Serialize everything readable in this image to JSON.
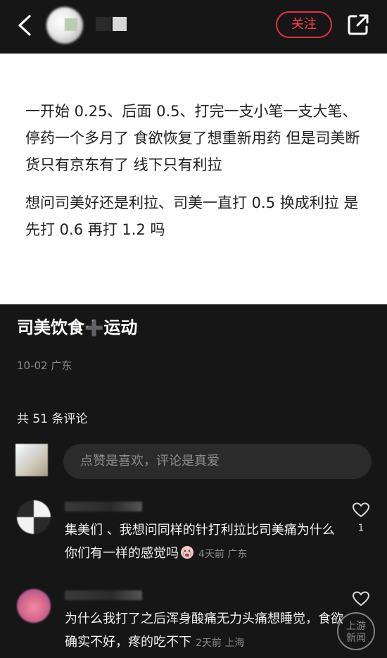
{
  "header": {
    "follow_label": "关注"
  },
  "post": {
    "paragraphs": [
      "一开始 0.25、后面 0.5、打完一支小笔一支大笔、停药一个多月了 食欲恢复了想重新用药 但是司美断货只有京东有了 线下只有利拉",
      "想问司美好还是利拉、司美一直打 0.5 换成利拉 是先打 0.6 再打 1.2 吗"
    ],
    "title_part1": "司美饮食",
    "title_plus": "➕",
    "title_part2": "运动",
    "meta": "10-02 广东"
  },
  "comments_section": {
    "count_label": "共 51 条评论",
    "input_placeholder": "点赞是喜欢，评论是真爱"
  },
  "comments": [
    {
      "text": "集美们 、我想问同样的针打利拉比司美痛为什么 你们有一样的感觉吗",
      "time": "4天前 广东",
      "likes": "1"
    },
    {
      "text": "为什么我打了之后浑身酸痛无力头痛想睡觉，食欲确实不好，疼的吃不下",
      "time": "2天前 上海",
      "likes": ""
    }
  ],
  "watermark": {
    "line1": "上游",
    "line2": "新闻"
  },
  "colors": {
    "background": "#161616",
    "accent": "#e2324a",
    "post_background": "#ffffff"
  }
}
